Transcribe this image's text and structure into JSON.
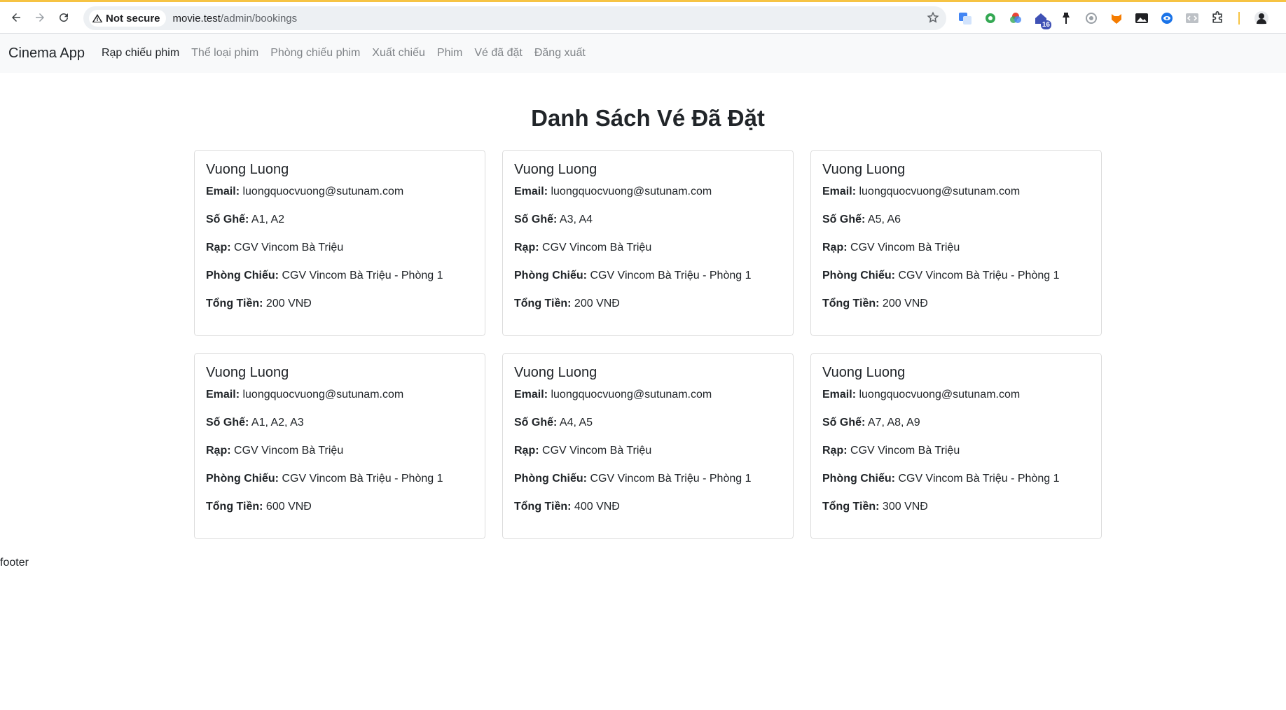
{
  "browser": {
    "security_label": "Not secure",
    "url_host": "movie.test",
    "url_path": "/admin/bookings",
    "extension_badge": "16"
  },
  "nav": {
    "brand": "Cinema App",
    "links": [
      "Rạp chiếu phim",
      "Thể loại phim",
      "Phòng chiếu phim",
      "Xuất chiếu",
      "Phim",
      "Vé đã đặt",
      "Đăng xuất"
    ]
  },
  "page": {
    "title": "Danh Sách Vé Đã Đặt",
    "footer": "footer"
  },
  "labels": {
    "email": "Email:",
    "seats": "Số Ghế:",
    "cinema": "Rạp:",
    "room": "Phòng Chiếu:",
    "total": "Tổng Tiền:"
  },
  "bookings": [
    {
      "name": "Vuong Luong",
      "email": "luongquocvuong@sutunam.com",
      "seats": "A1, A2",
      "cinema": "CGV Vincom Bà Triệu",
      "room": "CGV Vincom Bà Triệu - Phòng 1",
      "total": "200 VNĐ"
    },
    {
      "name": "Vuong Luong",
      "email": "luongquocvuong@sutunam.com",
      "seats": "A3, A4",
      "cinema": "CGV Vincom Bà Triệu",
      "room": "CGV Vincom Bà Triệu - Phòng 1",
      "total": "200 VNĐ"
    },
    {
      "name": "Vuong Luong",
      "email": "luongquocvuong@sutunam.com",
      "seats": "A5, A6",
      "cinema": "CGV Vincom Bà Triệu",
      "room": "CGV Vincom Bà Triệu - Phòng 1",
      "total": "200 VNĐ"
    },
    {
      "name": "Vuong Luong",
      "email": "luongquocvuong@sutunam.com",
      "seats": "A1, A2, A3",
      "cinema": "CGV Vincom Bà Triệu",
      "room": "CGV Vincom Bà Triệu - Phòng 1",
      "total": "600 VNĐ"
    },
    {
      "name": "Vuong Luong",
      "email": "luongquocvuong@sutunam.com",
      "seats": "A4, A5",
      "cinema": "CGV Vincom Bà Triệu",
      "room": "CGV Vincom Bà Triệu - Phòng 1",
      "total": "400 VNĐ"
    },
    {
      "name": "Vuong Luong",
      "email": "luongquocvuong@sutunam.com",
      "seats": "A7, A8, A9",
      "cinema": "CGV Vincom Bà Triệu",
      "room": "CGV Vincom Bà Triệu - Phòng 1",
      "total": "300 VNĐ"
    }
  ]
}
